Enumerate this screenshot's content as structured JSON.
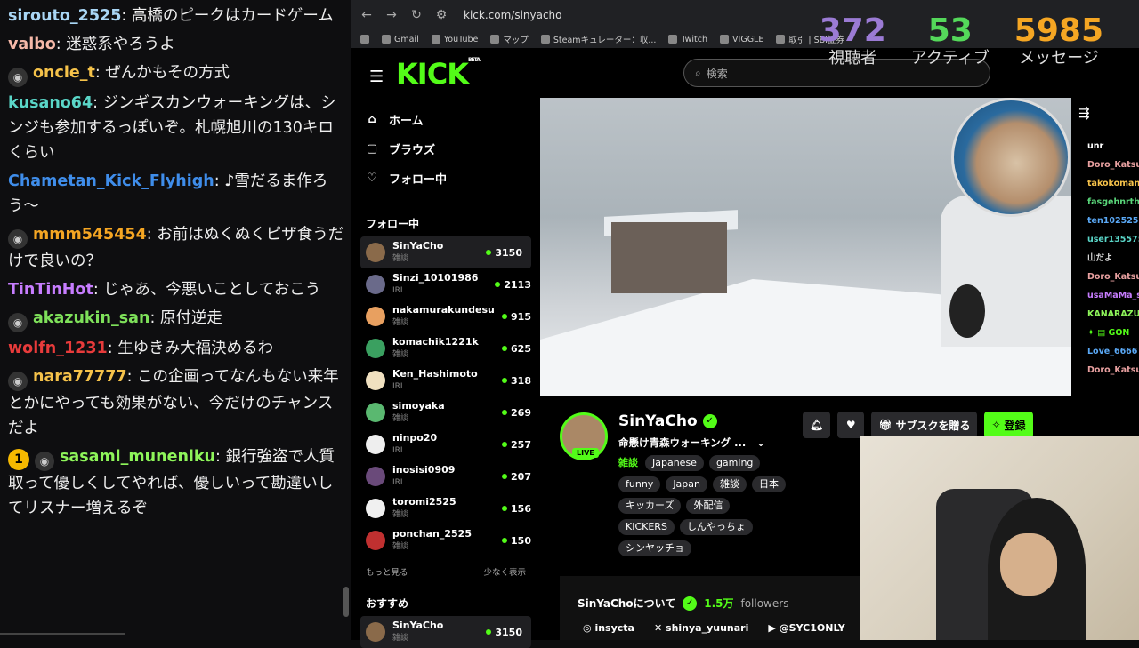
{
  "left_chat": [
    {
      "user": "sirouto_2525",
      "color": "#a9d6f5",
      "text": "高橋のピークはカードゲーム",
      "avatar": false,
      "badge": null
    },
    {
      "user": "valbo",
      "color": "#f5b8a8",
      "text": "迷惑系やろうよ",
      "avatar": false,
      "badge": null
    },
    {
      "user": "oncle_t",
      "color": "#f5c24a",
      "text": "ぜんかもその方式",
      "avatar": true,
      "badge": null
    },
    {
      "user": "kusano64",
      "color": "#5ad6c8",
      "text": "ジンギスカンウォーキングは、シンジも参加するっぽいぞ。札幌旭川の130キロくらい",
      "avatar": false,
      "badge": null
    },
    {
      "user": "Chametan_Kick_Flyhigh",
      "color": "#3f8dea",
      "text": "♪雪だるま作ろう〜",
      "avatar": false,
      "badge": null
    },
    {
      "user": "mmm545454",
      "color": "#f5a623",
      "text": "お前はぬくぬくピザ食うだけで良いの？",
      "avatar": true,
      "badge": null
    },
    {
      "user": "TinTinHot",
      "color": "#c77dff",
      "text": "じゃあ、今悪いことしておこう",
      "avatar": false,
      "badge": null
    },
    {
      "user": "akazukin_san",
      "color": "#7ee05a",
      "text": "原付逆走",
      "avatar": true,
      "badge": null
    },
    {
      "user": "wolfn_1231",
      "color": "#e83b3b",
      "text": "生ゆきみ大福決めるわ",
      "avatar": false,
      "badge": null
    },
    {
      "user": "nara77777",
      "color": "#f5c24a",
      "text": "この企画ってなんもない来年とかにやっても効果がない、今だけのチャンスだよ",
      "avatar": true,
      "badge": null
    },
    {
      "user": "sasami_muneniku",
      "color": "#8ef55a",
      "text": "銀行強盗で人質取って優しくしてやれば、優しいって勘違いしてリスナー増えるぞ",
      "avatar": true,
      "badge": "1"
    }
  ],
  "browser": {
    "url": "kick.com/sinyacho",
    "bookmarks": [
      "Gmail",
      "YouTube",
      "マップ",
      "Steamキュレーター：収...",
      "Twitch",
      "VIGGLE",
      "取引 | SBI証券"
    ]
  },
  "stats": [
    {
      "num": "372",
      "label": "視聴者",
      "color": "#9b7bd4"
    },
    {
      "num": "53",
      "label": "アクティブ",
      "color": "#54d85a"
    },
    {
      "num": "5985",
      "label": "メッセージ",
      "color": "#f5a623"
    }
  ],
  "kick": {
    "logo": "KICK",
    "logo_sup": "BETA",
    "search_placeholder": "検索",
    "nav": [
      {
        "label": "ホーム",
        "icon": "⌂"
      },
      {
        "label": "ブラウズ",
        "icon": "▢"
      },
      {
        "label": "フォロー中",
        "icon": "♡"
      }
    ],
    "following_header": "フォロー中",
    "following": [
      {
        "name": "SinYaCho",
        "cat": "雑談",
        "viewers": "3150",
        "active": true,
        "color": "#8a6a4a"
      },
      {
        "name": "Sinzi_10101986",
        "cat": "IRL",
        "viewers": "2113",
        "active": false,
        "color": "#6a6a8a"
      },
      {
        "name": "nakamurakundesu",
        "cat": "雑談",
        "viewers": "915",
        "active": false,
        "color": "#e8a060"
      },
      {
        "name": "komachik1221k",
        "cat": "雑談",
        "viewers": "625",
        "active": false,
        "color": "#3aa060"
      },
      {
        "name": "Ken_Hashimoto",
        "cat": "IRL",
        "viewers": "318",
        "active": false,
        "color": "#f0e0c0"
      },
      {
        "name": "simoyaka",
        "cat": "雑談",
        "viewers": "269",
        "active": false,
        "color": "#5ab870"
      },
      {
        "name": "ninpo20",
        "cat": "IRL",
        "viewers": "257",
        "active": false,
        "color": "#eeeeee"
      },
      {
        "name": "inosisi0909",
        "cat": "IRL",
        "viewers": "207",
        "active": false,
        "color": "#6a4a7a"
      },
      {
        "name": "toromi2525",
        "cat": "雑談",
        "viewers": "156",
        "active": false,
        "color": "#f0f0f0"
      },
      {
        "name": "ponchan_2525",
        "cat": "雑談",
        "viewers": "150",
        "active": false,
        "color": "#c03030"
      }
    ],
    "show_more": "もっと見る",
    "show_less": "少なく表示",
    "recommended_header": "おすすめ",
    "recommended": [
      {
        "name": "SinYaCho",
        "cat": "雑談",
        "viewers": "3150"
      }
    ]
  },
  "right_chat": [
    {
      "u": "unr",
      "c": "#ffffff"
    },
    {
      "u": "Doro_Katsu",
      "c": "#e8a0a0"
    },
    {
      "u": "takokoman",
      "c": "#f5c24a"
    },
    {
      "u": "fasgehnrth",
      "c": "#5ad67a"
    },
    {
      "u": "ten102525",
      "c": "#5aa8f5"
    },
    {
      "u": "user13557:",
      "c": "#5ad6c8"
    },
    {
      "u": "山だよ",
      "c": "#dddddd"
    },
    {
      "u": "Doro_Katsu",
      "c": "#e8a0a0"
    },
    {
      "u": "usaMaMa_s",
      "c": "#c77dff"
    },
    {
      "u": "KANARAZU",
      "c": "#8ef55a"
    },
    {
      "u": "✦ ▤ GON",
      "c": "#53fc18"
    },
    {
      "u": "Love_6666",
      "c": "#5aa8f5"
    },
    {
      "u": "Doro_Katsu",
      "c": "#e8a0a0"
    }
  ],
  "channel": {
    "name": "SinYaCho",
    "live": "LIVE",
    "title": "命懸け青森ウォーキング ...",
    "category": "雑談",
    "tags": [
      "Japanese",
      "gaming",
      "funny",
      "Japan",
      "雑談",
      "日本",
      "キッカーズ",
      "外配信",
      "KICKERS",
      "しんやっちょ",
      "シンヤッチョ"
    ],
    "subscribe_gift": "サブスクを贈る",
    "follow": "登録",
    "about_title": "SinYaChoについて",
    "followers_count": "1.5万",
    "followers_label": "followers",
    "socials": [
      {
        "icon": "instagram-icon",
        "label": "insycta"
      },
      {
        "icon": "x-icon",
        "label": "shinya_yuunari"
      },
      {
        "icon": "youtube-icon",
        "label": "@SYC1ONLY"
      }
    ]
  }
}
